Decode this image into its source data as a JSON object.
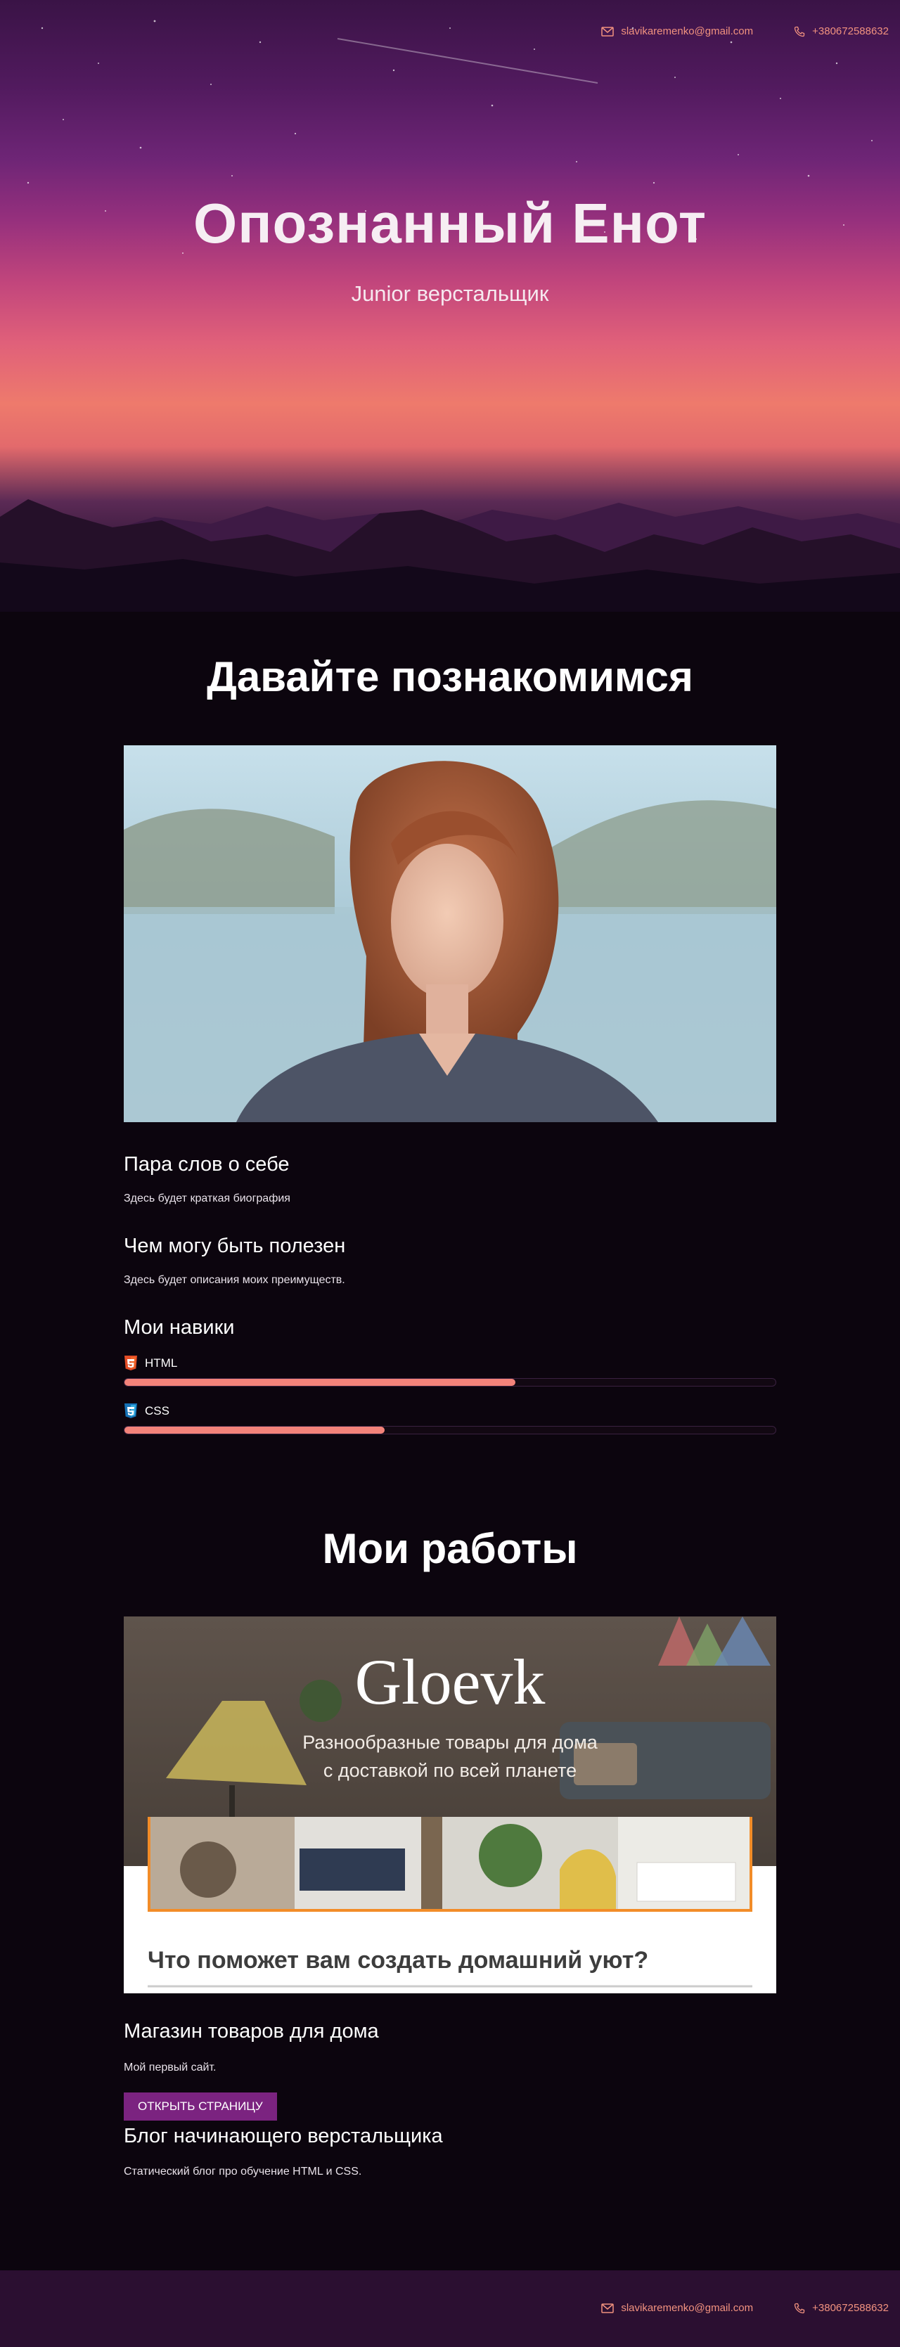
{
  "header": {
    "email": "slavikaremenko@gmail.com",
    "phone": "+380672588632",
    "email_icon": "envelope-icon",
    "phone_icon": "phone-icon"
  },
  "hero": {
    "title": "Опознанный Енот",
    "subtitle": "Junior верстальщик"
  },
  "about": {
    "title": "Давайте познакомимся",
    "bio_title": "Пара слов о себе",
    "bio_text": "Здесь будет краткая биография",
    "useful_title": "Чем могу быть полезен",
    "useful_text": "Здесь будет описания моих преимуществ.",
    "skills_title": "Мои навики",
    "skills": [
      {
        "name": "HTML",
        "icon": "html5-icon",
        "level": 0.6
      },
      {
        "name": "CSS",
        "icon": "css3-icon",
        "level": 0.4
      }
    ]
  },
  "works": {
    "title": "Мои работы",
    "preview": {
      "brand": "Gloevk",
      "tagline_1": "Разнообразные товары для дома",
      "tagline_2": "с доставкой по всей планете",
      "heading": "Что поможет вам создать домашний уют?"
    },
    "projects": [
      {
        "title": "Магазин товаров для дома",
        "text": "Мой первый сайт.",
        "button": "ОТКРЫТЬ СТРАНИЦУ"
      },
      {
        "title": "Блог начинающего верстальщика",
        "text": "Статический блог про обучение HTML и CSS."
      }
    ]
  },
  "footer": {
    "email": "slavikaremenko@gmail.com",
    "phone": "+380672588632"
  },
  "colors": {
    "accent": "#f3837a",
    "button": "#7b2380",
    "background": "#0c050e",
    "footer": "#2b0f31"
  }
}
